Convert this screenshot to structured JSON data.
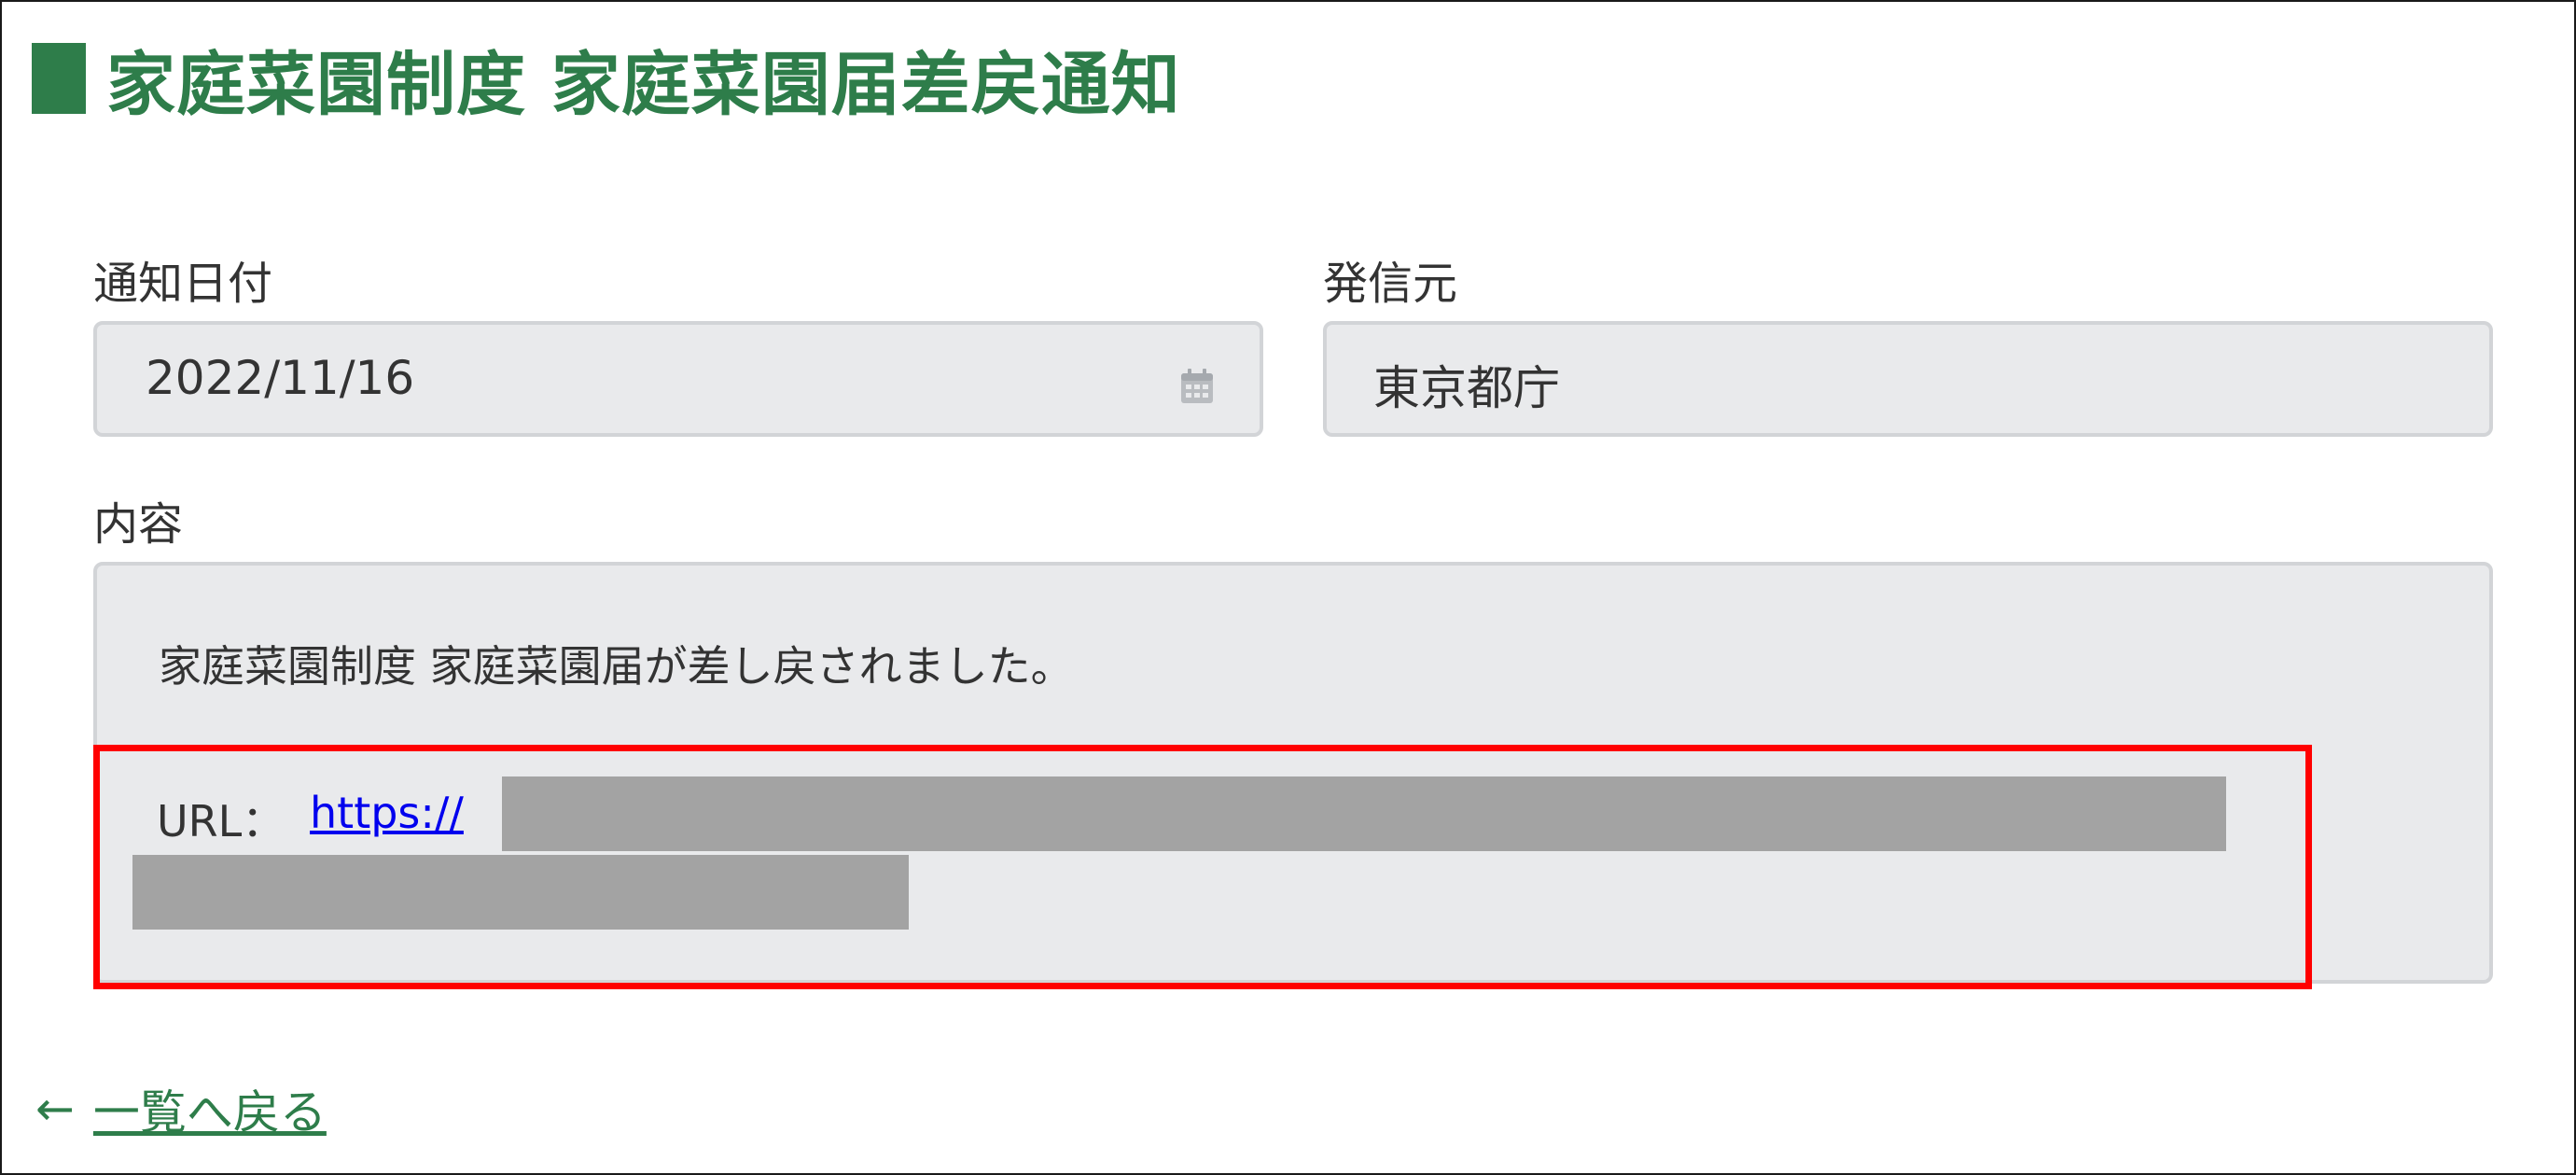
{
  "header": {
    "title": "家庭菜園制度 家庭菜園届差戻通知"
  },
  "form": {
    "date_label": "通知日付",
    "date_value": "2022/11/16",
    "sender_label": "発信元",
    "sender_value": "東京都庁",
    "content_label": "内容",
    "content_message": "家庭菜園制度 家庭菜園届が差し戻されました。",
    "url_prefix": "URL：",
    "url_link_text": "https://"
  },
  "nav": {
    "back_arrow": "←",
    "back_label": "一覧へ戻る"
  },
  "colors": {
    "accent": "#2e7d4a",
    "field_bg": "#e9eaec",
    "highlight": "#ff0000",
    "link": "#0000ee",
    "redaction": "#a3a3a3"
  },
  "icons": {
    "date_field": "calendar-icon",
    "back": "arrow-left-icon"
  }
}
